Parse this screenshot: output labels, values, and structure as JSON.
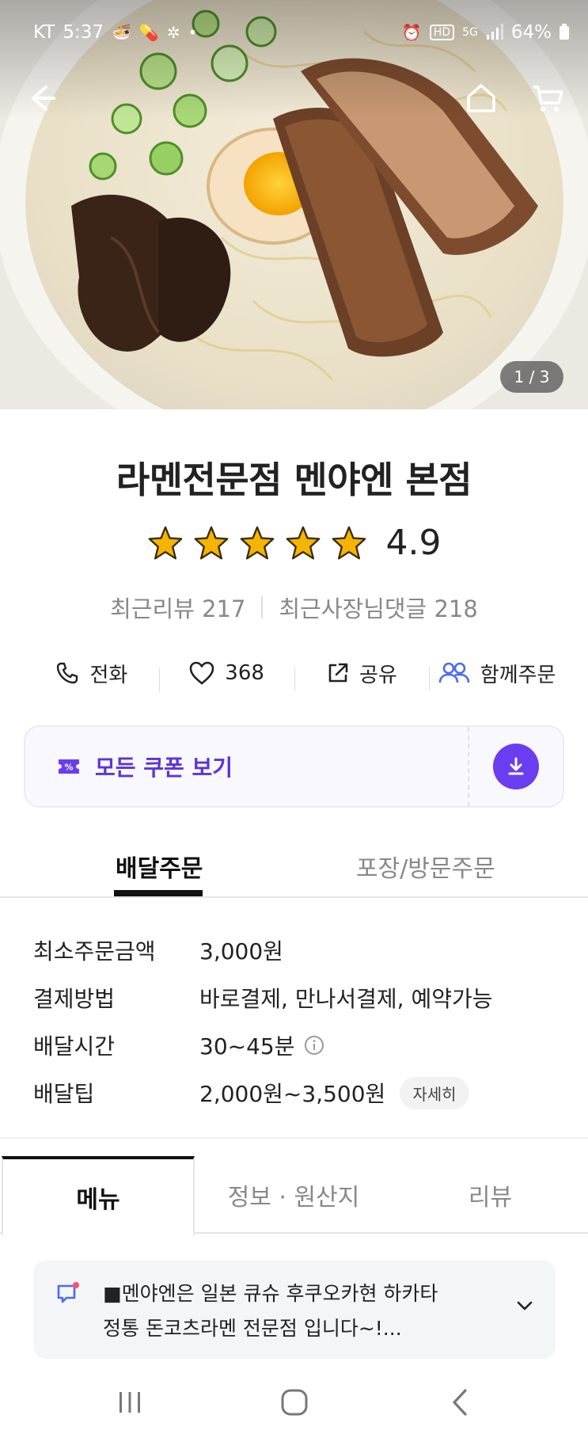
{
  "status_bar": {
    "carrier": "KT",
    "time": "5:37",
    "battery": "64%"
  },
  "hero": {
    "page_counter": "1 / 3"
  },
  "store": {
    "name": "라멘전문점 멘야엔 본점",
    "rating": "4.9",
    "star_count": 5,
    "recent_reviews": "최근리뷰 217",
    "owner_replies": "최근사장님댓글 218"
  },
  "actions": {
    "call": "전화",
    "likes": "368",
    "share": "공유",
    "group_order": "함께주문"
  },
  "coupon": {
    "label": "모든 쿠폰 보기"
  },
  "order_tabs": {
    "delivery": "배달주문",
    "pickup": "포장/방문주문"
  },
  "info": {
    "rows": [
      {
        "label": "최소주문금액",
        "value": "3,000원"
      },
      {
        "label": "결제방법",
        "value": "바로결제, 만나서결제, 예약가능"
      },
      {
        "label": "배달시간",
        "value": "30~45분"
      },
      {
        "label": "배달팁",
        "value": "2,000원~3,500원"
      }
    ],
    "detail_chip": "자세히"
  },
  "content_tabs": {
    "menu": "메뉴",
    "info": "정보 · 원산지",
    "review": "리뷰"
  },
  "notice": {
    "line1": "■멘야엔은 일본 큐슈 후쿠오카현 하카타",
    "line2": "정통 돈코츠라멘 전문점 입니다~!..."
  },
  "colors": {
    "accent": "#6a3df0",
    "coupon_text": "#5a35d8",
    "star": "#f5b400",
    "group_icon": "#4a6cf0"
  }
}
